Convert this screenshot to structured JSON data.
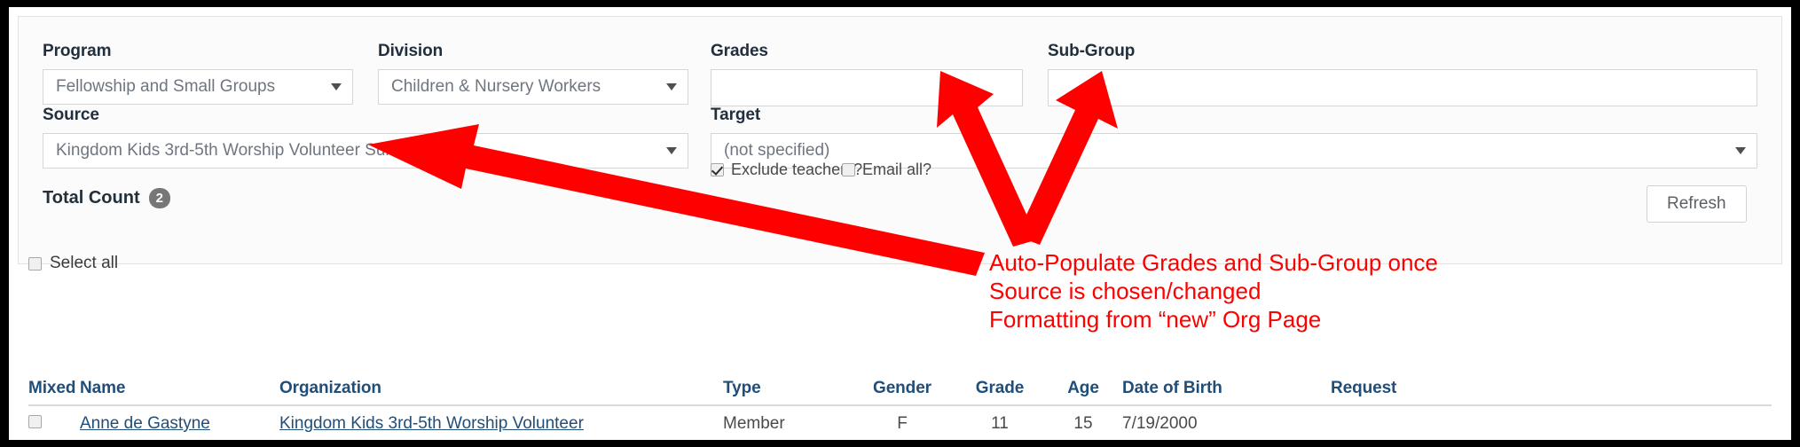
{
  "filters": {
    "program": {
      "label": "Program",
      "value": "Fellowship and Small Groups"
    },
    "division": {
      "label": "Division",
      "value": "Children & Nursery Workers"
    },
    "grades": {
      "label": "Grades",
      "value": ""
    },
    "subgroup": {
      "label": "Sub-Group",
      "value": ""
    },
    "source": {
      "label": "Source",
      "value": "Kingdom Kids 3rd-5th Worship Volunteer Sun 10:00 AM"
    },
    "target": {
      "label": "Target",
      "value": "(not specified)"
    },
    "exclude_teachers": {
      "label": "Exclude teachers?",
      "checked": true
    },
    "email_all": {
      "label": "Email all?",
      "checked": false
    }
  },
  "summary": {
    "total_count_label": "Total Count",
    "total_count_value": "2",
    "refresh_label": "Refresh"
  },
  "list": {
    "select_all_label": "Select all",
    "columns": {
      "mixed": "Mixed",
      "name": "Name",
      "organization": "Organization",
      "type": "Type",
      "gender": "Gender",
      "grade": "Grade",
      "age": "Age",
      "dob": "Date of Birth",
      "request": "Request"
    },
    "rows": [
      {
        "name": "Anne de Gastyne",
        "organization": "Kingdom Kids 3rd-5th Worship Volunteer",
        "type": "Member",
        "gender": "F",
        "grade": "11",
        "age": "15",
        "dob": "7/19/2000",
        "request": "",
        "selected": false
      }
    ]
  },
  "annotation": {
    "line1": "Auto-Populate Grades and Sub-Group once",
    "line2": "Source is chosen/changed",
    "line3": "Formatting from “new” Org Page",
    "color": "#ff0000"
  },
  "colors": {
    "annotation_red": "#ff0000",
    "header_blue": "#1f4e79",
    "badge_gray": "#777777",
    "panel_bg": "#fbfbfb",
    "page_bg": "#ffffff",
    "letterbox": "#000000"
  }
}
